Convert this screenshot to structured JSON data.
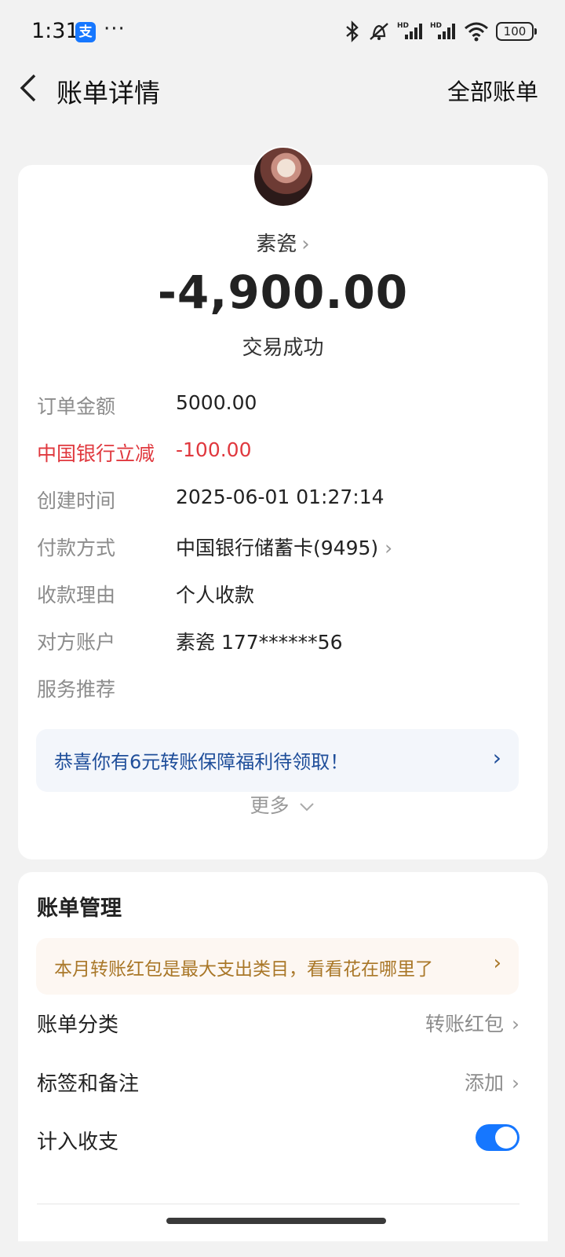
{
  "status_bar": {
    "time": "1:31",
    "alipay_badge": "支",
    "dots": "···",
    "battery": "100",
    "icons": [
      "bluetooth-icon",
      "mute-icon",
      "hd-signal-icon",
      "hd-signal-icon",
      "wifi-icon",
      "battery-icon"
    ]
  },
  "header": {
    "title": "账单详情",
    "right_link": "全部账单"
  },
  "transaction": {
    "payee": "素瓷",
    "amount": "-4,900.00",
    "status": "交易成功",
    "details": [
      {
        "label": "订单金额",
        "value": "5000.00"
      },
      {
        "label": "中国银行立减",
        "value": "-100.00"
      },
      {
        "label": "创建时间",
        "value": "2025-06-01 01:27:14"
      },
      {
        "label": "付款方式",
        "value": "中国银行储蓄卡(9495)"
      },
      {
        "label": "收款理由",
        "value": "个人收款"
      },
      {
        "label": "对方账户",
        "value": "素瓷 177******56"
      },
      {
        "label": "服务推荐",
        "value": ""
      }
    ],
    "promo": "恭喜你有6元转账保障福利待领取！",
    "more": "更多"
  },
  "management": {
    "title": "账单管理",
    "promo": "本月转账红包是最大支出类目，看看花在哪里了",
    "rows": [
      {
        "label": "账单分类",
        "value": "转账红包"
      },
      {
        "label": "标签和备注",
        "value": "添加"
      },
      {
        "label": "计入收支",
        "value": ""
      }
    ],
    "toggle_on": true
  },
  "colors": {
    "accent": "#1677ff",
    "discount_red": "#e0383e",
    "promo_blue_text": "#1f4e9a",
    "promo_orange_text": "#a97728"
  }
}
